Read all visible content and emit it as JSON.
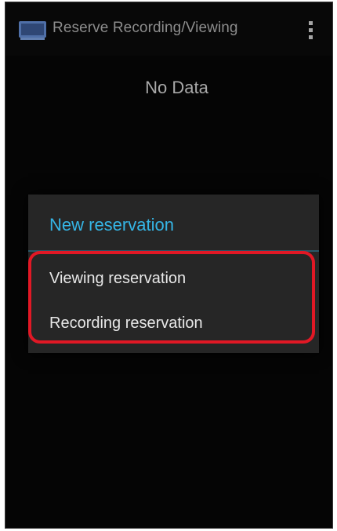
{
  "action_bar": {
    "title": "Reserve Recording/Viewing",
    "app_icon": "tv-icon",
    "overflow_icon": "overflow-menu-icon"
  },
  "main": {
    "empty_message": "No Data"
  },
  "dialog": {
    "title": "New reservation",
    "items": [
      {
        "label": "Viewing reservation"
      },
      {
        "label": "Recording reservation"
      }
    ]
  },
  "colors": {
    "accent": "#35b5e5",
    "highlight": "#e11825",
    "background": "#050505",
    "dialog_background": "#262626"
  }
}
